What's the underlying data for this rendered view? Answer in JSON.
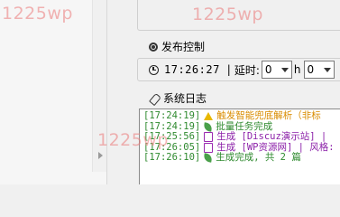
{
  "watermark": "1225wp",
  "publish": {
    "title": "发布控制",
    "time": "17:26:27",
    "separator": "|",
    "delay_label": "延时:",
    "hours_value": "0",
    "hours_unit": "h",
    "minutes_value": "0"
  },
  "log": {
    "title": "系统日志",
    "entries": [
      {
        "time": "[17:24:19]",
        "icon": "warning-icon",
        "text": "触发智能兜底解析（非标",
        "color": "#d98c00"
      },
      {
        "time": "[17:24:19]",
        "icon": "leaf-icon",
        "text": "批量任务完成",
        "color": "#2f8a2f"
      },
      {
        "time": "[17:25:56]",
        "icon": "document-icon",
        "text": "生成 [Discuz演示站] |",
        "color": "#8b1fa8"
      },
      {
        "time": "[17:26:05]",
        "icon": "document-icon",
        "text": "生成 [WP资源网] | 风格:",
        "color": "#8b1fa8"
      },
      {
        "time": "[17:26:10]",
        "icon": "leaf-icon",
        "text": "生成完成, 共 2 篇",
        "color": "#2f8a2f"
      }
    ]
  }
}
